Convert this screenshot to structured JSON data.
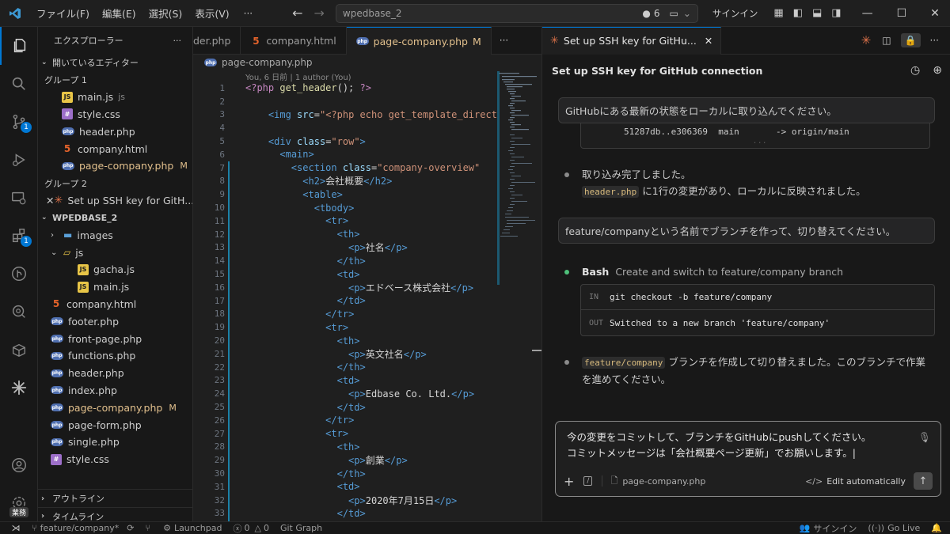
{
  "titlebar": {
    "menus": [
      "ファイル(F)",
      "編集(E)",
      "選択(S)",
      "表示(V)"
    ],
    "more": "···",
    "search": "wpedbase_2",
    "count": "6",
    "signin": "サインイン"
  },
  "activity": {
    "badge_scm": "1",
    "badge_ext": "1",
    "manage_label": "業務"
  },
  "sidebar": {
    "title": "エクスプローラー",
    "more": "···",
    "open_editors_label": "開いているエディター",
    "group1_label": "グループ 1",
    "group1_items": [
      {
        "icon": "js",
        "name": "main.js",
        "hint": "js",
        "badge": ""
      },
      {
        "icon": "css",
        "name": "style.css",
        "hint": "",
        "badge": ""
      },
      {
        "icon": "php",
        "name": "header.php",
        "hint": "",
        "badge": ""
      },
      {
        "icon": "html",
        "name": "company.html",
        "hint": "",
        "badge": ""
      },
      {
        "icon": "php",
        "name": "page-company.php",
        "hint": "",
        "badge": "M"
      }
    ],
    "group2_label": "グループ 2",
    "group2_item": "Set up SSH key for GitH...",
    "project_label": "WPEDBASE_2",
    "tree": [
      {
        "type": "folder",
        "name": "images",
        "indent": 1,
        "open": false
      },
      {
        "type": "folder",
        "name": "js",
        "indent": 1,
        "open": true
      },
      {
        "type": "js",
        "name": "gacha.js",
        "indent": 2
      },
      {
        "type": "js",
        "name": "main.js",
        "indent": 2
      },
      {
        "type": "html",
        "name": "company.html",
        "indent": 1
      },
      {
        "type": "php",
        "name": "footer.php",
        "indent": 1
      },
      {
        "type": "php",
        "name": "front-page.php",
        "indent": 1
      },
      {
        "type": "php",
        "name": "functions.php",
        "indent": 1
      },
      {
        "type": "php",
        "name": "header.php",
        "indent": 1
      },
      {
        "type": "php",
        "name": "index.php",
        "indent": 1
      },
      {
        "type": "php",
        "name": "page-company.php",
        "indent": 1,
        "badge": "M"
      },
      {
        "type": "php",
        "name": "page-form.php",
        "indent": 1
      },
      {
        "type": "php",
        "name": "single.php",
        "indent": 1
      },
      {
        "type": "css",
        "name": "style.css",
        "indent": 1
      }
    ],
    "outline_label": "アウトライン",
    "timeline_label": "タイムライン"
  },
  "editor": {
    "tabs": [
      {
        "label": "der.php",
        "icon": "",
        "modified": ""
      },
      {
        "label": "company.html",
        "icon": "html",
        "modified": ""
      },
      {
        "label": "page-company.php",
        "icon": "php",
        "modified": "M"
      }
    ],
    "tab_more": "···",
    "breadcrumb": "page-company.php",
    "blame": "You, 6 日前 | 1 author (You)",
    "line_numbers": [
      "1",
      "2",
      "3",
      "4",
      "5",
      "6",
      "7",
      "8",
      "9",
      "10",
      "11",
      "12",
      "13",
      "14",
      "15",
      "16",
      "17",
      "18",
      "19",
      "20",
      "21",
      "22",
      "23",
      "24",
      "25",
      "26",
      "27",
      "28",
      "29",
      "30",
      "31",
      "32",
      "33"
    ],
    "lines": [
      "<?php get_header(); ?>",
      "",
      "    <img src=\"<?php echo get_template_direct",
      "",
      "    <div class=\"row\">",
      "      <main>",
      "        <section class=\"company-overview\"",
      "          <h2>会社概要</h2>",
      "          <table>",
      "            <tbody>",
      "              <tr>",
      "                <th>",
      "                  <p>社名</p>",
      "                </th>",
      "                <td>",
      "                  <p>エドベース株式会社</p>",
      "                </td>",
      "              </tr>",
      "              <tr>",
      "                <th>",
      "                  <p>英文社名</p>",
      "                </th>",
      "                <td>",
      "                  <p>Edbase Co. Ltd.</p>",
      "                </td>",
      "              </tr>",
      "              <tr>",
      "                <th>",
      "                  <p>創業</p>",
      "                </th>",
      "                <td>",
      "                  <p>2020年7月15日</p>",
      "                </td>"
    ]
  },
  "chat": {
    "tab_label": "Set up SSH key for GitHu...",
    "title": "Set up SSH key for GitHub connection",
    "msg1": "GitHubにある最新の状態をローカルに取り込んでください。",
    "code_out": "51287db..e306369  main       -> origin/main",
    "code_faded": "                           ...",
    "reply1_line1": "取り込み完了しました。",
    "reply1_code": "header.php",
    "reply1_rest": "に1行の変更があり、ローカルに反映されました。",
    "msg2": "feature/companyという名前でブランチを作って、切り替えてください。",
    "bash_label": "Bash",
    "bash_desc": "Create and switch to feature/company branch",
    "in_label": "IN",
    "in_cmd": "git checkout -b feature/company",
    "out_label": "OUT",
    "out_text": "Switched to a new branch 'feature/company'",
    "reply2_code": "feature/company",
    "reply2_rest": "ブランチを作成して切り替えました。このブランチで作業",
    "reply2_line2": "を進めてください。",
    "input_line1": "今の変更をコミットして、ブランチをGitHubにpushしてください。",
    "input_line2": "コミットメッセージは「会社概要ページ更新」でお願いします。",
    "attach_file": "page-company.php",
    "edit_mode": "Edit automatically"
  },
  "status": {
    "branch": "feature/company*",
    "errors": "0",
    "warnings": "0",
    "launchpad": "Launchpad",
    "gitgraph": "Git Graph",
    "signin": "サインイン",
    "golive": "Go Live"
  },
  "colors": {
    "accent": "#0078d4",
    "modified": "#e2c08d",
    "claude": "#e0734a"
  }
}
